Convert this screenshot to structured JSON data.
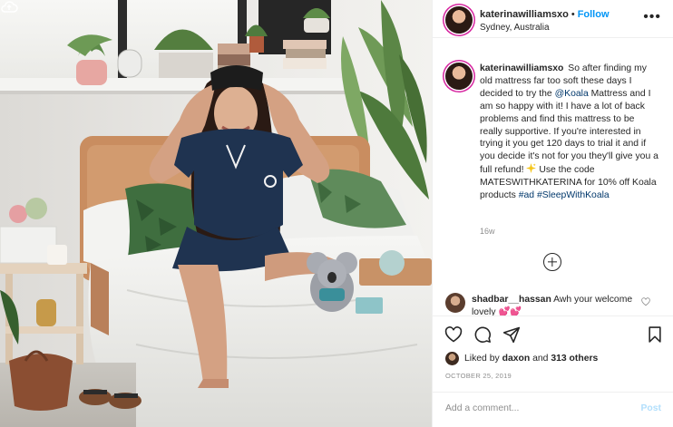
{
  "post": {
    "multi_icon": "cloud-icon",
    "photo_alt": "Woman in navy satin pajamas sitting on a white bed holding a sleep mask, with a koala plush toy"
  },
  "header": {
    "username": "katerinawilliamsxo",
    "dot": "•",
    "follow_label": "Follow",
    "location": "Sydney, Australia",
    "more_icon": "more-horizontal-icon"
  },
  "caption": {
    "username": "katerinawilliamsxo",
    "text_before_mention": "So after finding my old mattress far too soft these days I decided to try the",
    "mention": "@Koala",
    "text_after_mention": "Mattress and I am so happy with it! I have a lot of back problems and find this mattress to be really supportive. If you're interested in trying it you get 120 days to trial it and if you decide it's not for you they'll give you a full refund!",
    "sparkle_icon": "sparkles-icon",
    "text_after_sparkle": "Use the code MATESWITHKATERINA for 10% off Koala products",
    "hashtag_1": "#ad",
    "hashtag_2": "#SleepWithKoala",
    "time": "16w"
  },
  "comment": {
    "username": "shadbar__hassan",
    "text": "Awh your welcome lovely 💕💕"
  },
  "actions": {
    "like_icon": "heart-icon",
    "comment_icon": "comment-icon",
    "share_icon": "paper-plane-icon",
    "save_icon": "bookmark-icon"
  },
  "likes": {
    "prefix": "Liked by",
    "user": "daxon",
    "and": "and",
    "others": "313 others"
  },
  "date": "OCTOBER 25, 2019",
  "add_comment": {
    "placeholder": "Add a comment...",
    "post_label": "Post"
  },
  "colors": {
    "link_blue": "#0095f6",
    "hashtag": "#00376b",
    "muted": "#8e8e8e",
    "post_disabled": "#b2dffc",
    "pajama_navy": "#1f3350"
  }
}
